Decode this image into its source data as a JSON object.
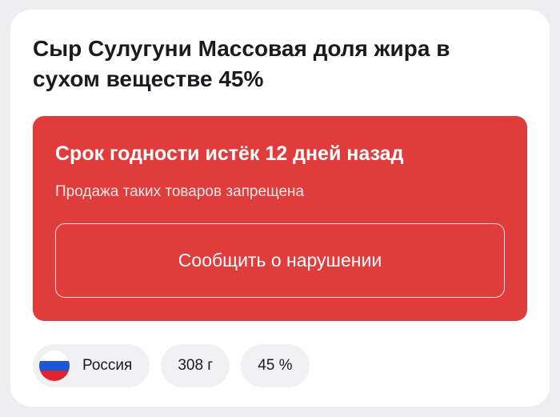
{
  "product": {
    "title": "Сыр Сулугуни Массовая доля жира в сухом веществе 45%"
  },
  "alert": {
    "title": "Срок годности истёк 12 дней назад",
    "subtitle": "Продажа таких товаров запрещена",
    "button_label": "Сообщить о нарушении",
    "color": "#e13c3c"
  },
  "chips": {
    "country": {
      "label": "Россия",
      "flag_icon": "russia-flag-icon",
      "flag_colors": [
        "#ffffff",
        "#1c57d6",
        "#e0242d"
      ]
    },
    "weight": {
      "label": "308 г"
    },
    "fat": {
      "label": "45 %"
    }
  }
}
